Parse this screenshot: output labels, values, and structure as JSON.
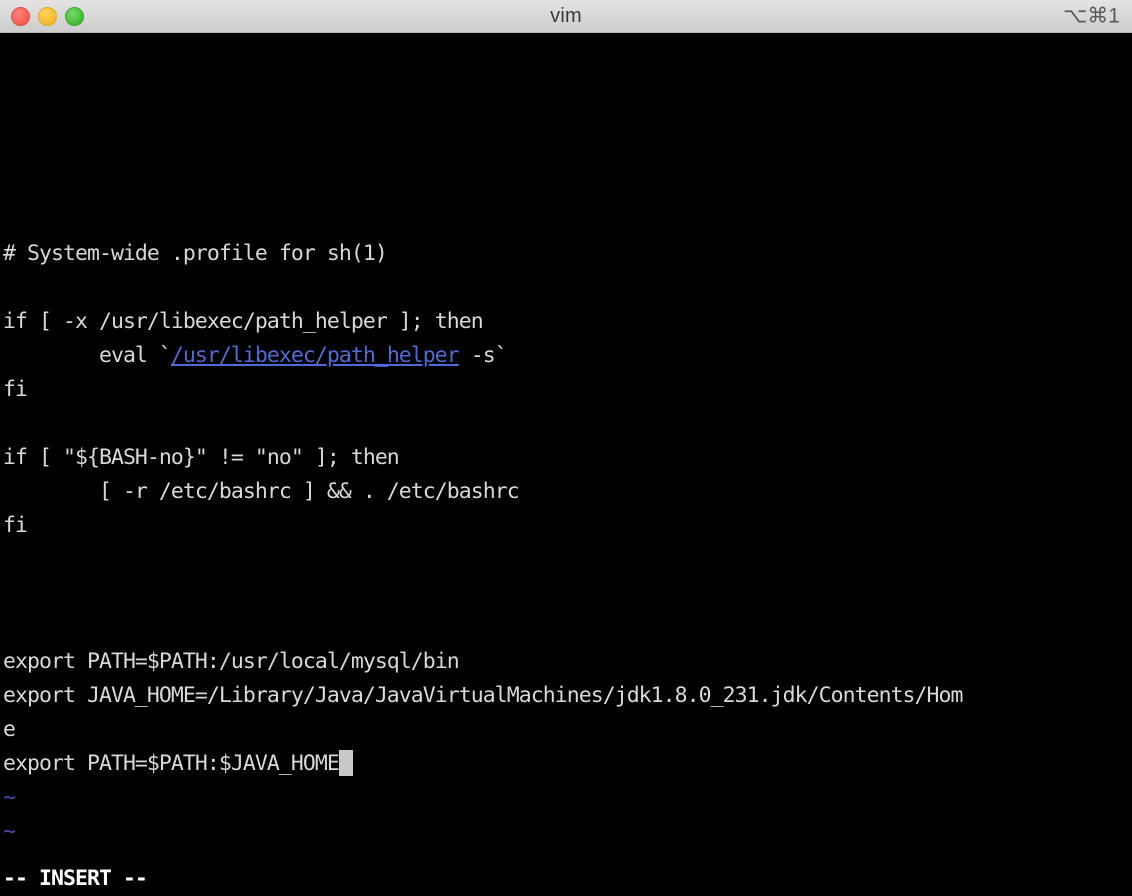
{
  "window": {
    "title": "vim",
    "shortcut_hint": "⌥⌘1",
    "traffic_lights": {
      "close_label": "close",
      "minimize_label": "minimize",
      "maximize_label": "maximize"
    },
    "colors": {
      "titlebar_top": "#e4e4e4",
      "titlebar_bottom": "#cdcdcd",
      "titlebar_border": "#b4b4b4",
      "close": "#f4655b",
      "minimize": "#f7c033",
      "maximize": "#4cc13f",
      "terminal_bg": "#000000",
      "terminal_fg": "#d8d8d8",
      "tilde": "#4a4ab0",
      "link": "#4f6bd6",
      "cursor": "#c9c9c9"
    }
  },
  "editor": {
    "mode_status": "-- INSERT --",
    "lines": [
      {
        "kind": "blank",
        "text": ""
      },
      {
        "kind": "blank",
        "text": ""
      },
      {
        "kind": "blank",
        "text": ""
      },
      {
        "kind": "blank",
        "text": ""
      },
      {
        "kind": "blank",
        "text": ""
      },
      {
        "kind": "blank",
        "text": ""
      },
      {
        "kind": "text",
        "text": "# System-wide .profile for sh(1)"
      },
      {
        "kind": "blank",
        "text": ""
      },
      {
        "kind": "text",
        "text": "if [ -x /usr/libexec/path_helper ]; then"
      },
      {
        "kind": "link",
        "prefix": "        eval `",
        "link_text": "/usr/libexec/path_helper",
        "suffix": " -s`"
      },
      {
        "kind": "text",
        "text": "fi"
      },
      {
        "kind": "blank",
        "text": ""
      },
      {
        "kind": "text",
        "text": "if [ \"${BASH-no}\" != \"no\" ]; then"
      },
      {
        "kind": "text",
        "text": "        [ -r /etc/bashrc ] && . /etc/bashrc"
      },
      {
        "kind": "text",
        "text": "fi"
      },
      {
        "kind": "blank",
        "text": ""
      },
      {
        "kind": "blank",
        "text": ""
      },
      {
        "kind": "blank",
        "text": ""
      },
      {
        "kind": "text",
        "text": "export PATH=$PATH:/usr/local/mysql/bin"
      },
      {
        "kind": "text",
        "text": "export JAVA_HOME=/Library/Java/JavaVirtualMachines/jdk1.8.0_231.jdk/Contents/Hom"
      },
      {
        "kind": "text",
        "text": "e"
      },
      {
        "kind": "cursor",
        "text": "export PATH=$PATH:$JAVA_HOME"
      },
      {
        "kind": "tilde",
        "text": "~"
      },
      {
        "kind": "tilde",
        "text": "~"
      }
    ]
  }
}
